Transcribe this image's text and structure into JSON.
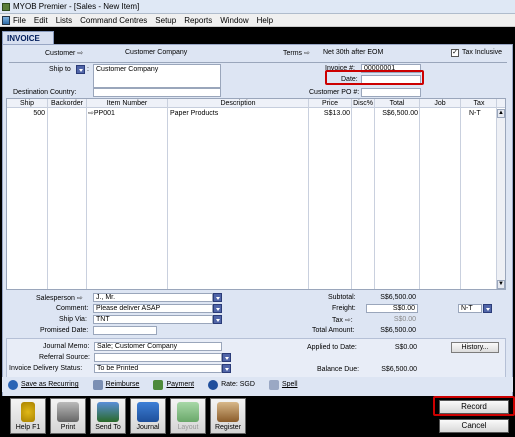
{
  "window": {
    "title": "MYOB Premier - [Sales - New Item]"
  },
  "menu": [
    "File",
    "Edit",
    "Lists",
    "Command Centres",
    "Setup",
    "Reports",
    "Window",
    "Help"
  ],
  "tab": "INVOICE",
  "header": {
    "customer_label": "Customer",
    "customer_value": "Customer Company",
    "terms_label": "Terms",
    "terms_value": "Net 30th after EOM",
    "tax_inclusive_label": "Tax Inclusive",
    "tax_inclusive_checked": "✓",
    "ship_to_label": "Ship to",
    "ship_to_value": "Customer Company",
    "invoice_no_label": "Invoice #:",
    "invoice_no_value": "00000001",
    "date_label": "Date:",
    "date_value": "",
    "dest_country_label": "Destination Country:",
    "dest_country_value": "",
    "customer_po_label": "Customer PO #:",
    "customer_po_value": ""
  },
  "grid": {
    "columns": [
      "Ship",
      "Backorder",
      "Item Number",
      "Description",
      "Price",
      "Disc%",
      "Total",
      "Job",
      "Tax"
    ],
    "rows": [
      {
        "ship": "500",
        "backorder": "",
        "item": "PP001",
        "description": "Paper Products",
        "price": "S$13.00",
        "disc": "",
        "total": "S$6,500.00",
        "job": "",
        "tax": "N-T"
      }
    ]
  },
  "footer": {
    "salesperson_label": "Salesperson",
    "salesperson_value": "J., Mr.",
    "comment_label": "Comment:",
    "comment_value": "Please deliver ASAP",
    "ship_via_label": "Ship Via:",
    "ship_via_value": "TNT",
    "promised_date_label": "Promised Date:",
    "promised_date_value": "",
    "subtotal_label": "Subtotal:",
    "subtotal_value": "S$6,500.00",
    "freight_label": "Freight:",
    "freight_value": "S$0.00",
    "freight_tax": "N-T",
    "tax_label": "Tax",
    "tax_value": "S$0.00",
    "total_amount_label": "Total Amount:",
    "total_amount_value": "S$6,500.00"
  },
  "journal": {
    "memo_label": "Journal Memo:",
    "memo_value": "Sale; Customer Company",
    "referral_label": "Referral Source:",
    "referral_value": "",
    "delivery_label": "Invoice Delivery Status:",
    "delivery_value": "To be Printed",
    "applied_label": "Applied to Date:",
    "applied_value": "S$0.00",
    "balance_label": "Balance Due:",
    "balance_value": "S$6,500.00",
    "history_button": "History..."
  },
  "actions": [
    "Save as Recurring",
    "Reimburse",
    "Payment",
    "Rate: SGD",
    "Spell"
  ],
  "toolbar": [
    "Help F1",
    "Print",
    "Send To",
    "Journal",
    "Layout",
    "Register"
  ],
  "buttons": {
    "record": "Record",
    "cancel": "Cancel"
  },
  "colors": {
    "highlight": "#cc0000",
    "panel": "#dde5f3",
    "dropdown": "#5065a8"
  }
}
